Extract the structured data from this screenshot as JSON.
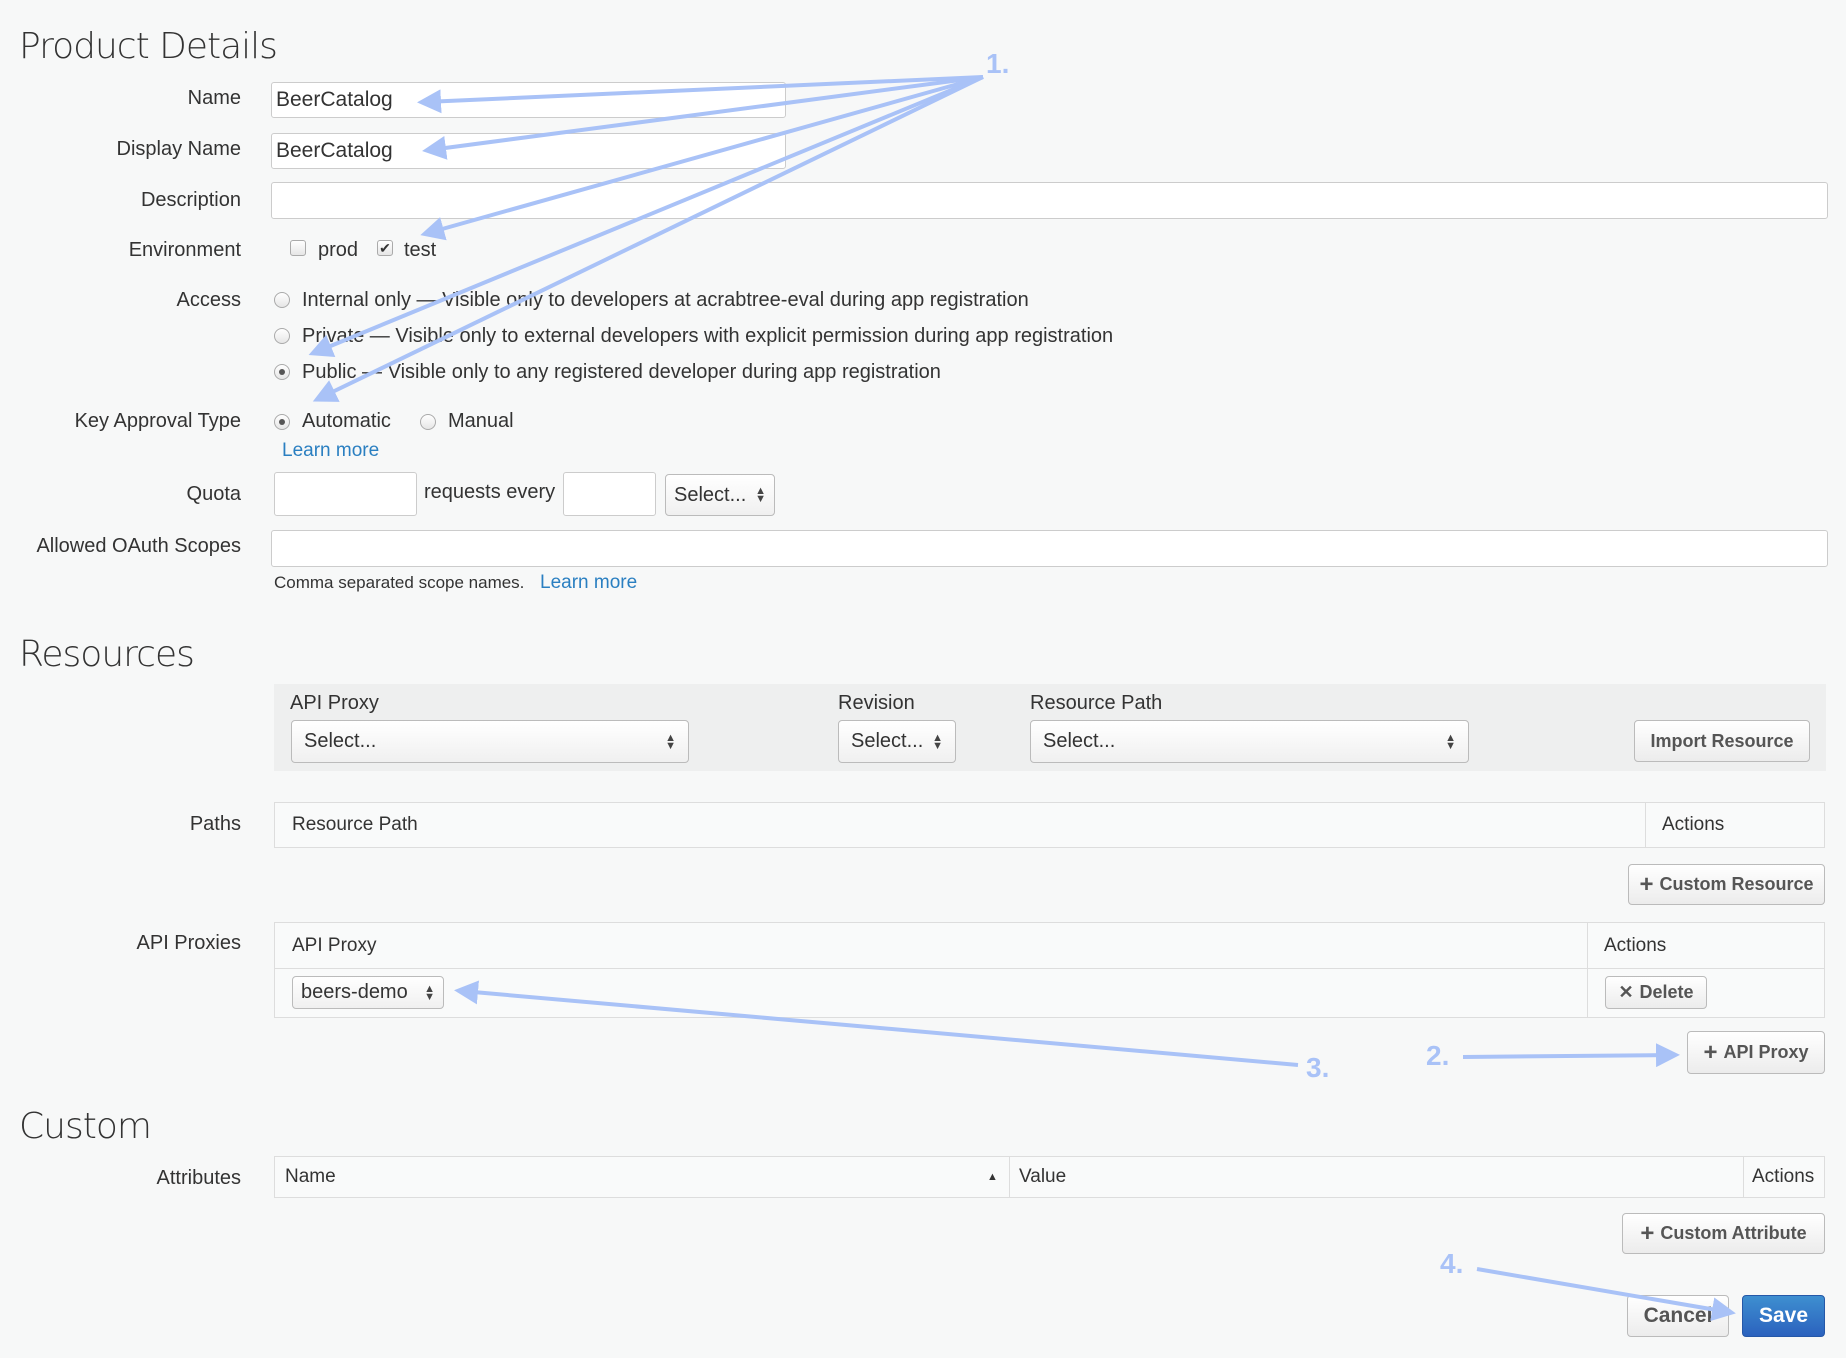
{
  "product_details": {
    "title": "Product Details",
    "name": {
      "label": "Name",
      "value": "BeerCatalog"
    },
    "display_name": {
      "label": "Display Name",
      "value": "BeerCatalog"
    },
    "description": {
      "label": "Description",
      "value": ""
    },
    "environment": {
      "label": "Environment",
      "options": [
        {
          "label": "prod",
          "checked": false
        },
        {
          "label": "test",
          "checked": true
        }
      ]
    },
    "access": {
      "label": "Access",
      "options": [
        {
          "label": "Internal only — Visible only to developers at acrabtree-eval during app registration",
          "selected": false
        },
        {
          "label": "Private — Visible only to external developers with explicit permission during app registration",
          "selected": false
        },
        {
          "label": "Public — Visible only to any registered developer during app registration",
          "selected": true
        }
      ]
    },
    "key_approval": {
      "label": "Key Approval Type",
      "options": [
        {
          "label": "Automatic",
          "selected": true
        },
        {
          "label": "Manual",
          "selected": false
        }
      ],
      "learn_more": "Learn more"
    },
    "quota": {
      "label": "Quota",
      "requests_every": "requests every",
      "select": "Select..."
    },
    "oauth": {
      "label": "Allowed OAuth Scopes",
      "help": "Comma separated scope names.",
      "learn_more": "Learn more"
    }
  },
  "resources": {
    "title": "Resources",
    "api_proxy_label": "API Proxy",
    "api_proxy_select": "Select...",
    "revision_label": "Revision",
    "revision_select": "Select...",
    "resource_path_label": "Resource Path",
    "resource_path_select": "Select...",
    "import_button": "Import Resource",
    "paths": {
      "label": "Paths",
      "col_path": "Resource Path",
      "col_actions": "Actions"
    },
    "custom_resource_button": "Custom Resource",
    "api_proxies": {
      "label": "API Proxies",
      "col_proxy": "API Proxy",
      "col_actions": "Actions",
      "rows": [
        {
          "proxy": "beers-demo",
          "action": "Delete"
        }
      ]
    },
    "add_proxy_button": "API Proxy"
  },
  "custom": {
    "title": "Custom",
    "attributes": {
      "label": "Attributes",
      "col_name": "Name",
      "col_value": "Value",
      "col_actions": "Actions"
    },
    "add_attribute_button": "Custom Attribute"
  },
  "footer": {
    "cancel": "Cancel",
    "save": "Save"
  },
  "annotations": {
    "a1": "1.",
    "a2": "2.",
    "a3": "3.",
    "a4": "4.",
    "color": "#a9c2f7"
  },
  "colors": {
    "link": "#2a7fc1",
    "save": "#2f6fc4"
  }
}
